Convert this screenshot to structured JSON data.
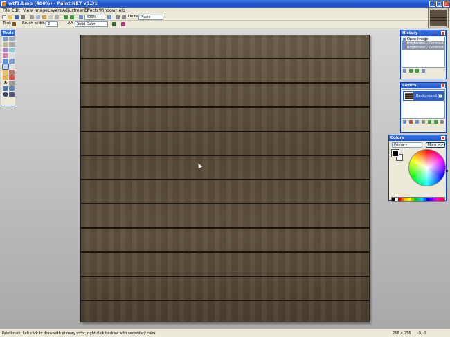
{
  "window": {
    "title": "wtf1.bmp (400%) - Paint.NET v3.31",
    "min_label": "_",
    "max_label": "□",
    "close_label": "×"
  },
  "menu": [
    "File",
    "Edit",
    "View",
    "Image",
    "Layers",
    "Adjustments",
    "Effects",
    "Window",
    "Help"
  ],
  "toolbar": {
    "zoom_value": "400%",
    "units_label": "Units:",
    "units_value": "Pixels"
  },
  "tool_options": {
    "tool_label": "Tool:",
    "brush_width_label": "Brush width:",
    "brush_width_value": "2",
    "aa_label": "AA",
    "fill_label": "Solid Color"
  },
  "panels": {
    "tools": {
      "title": "Tools"
    },
    "history": {
      "title": "History",
      "items": [
        {
          "label": "Open Image",
          "state": "active"
        },
        {
          "label": "Brightness / Contrast",
          "state": "undone"
        },
        {
          "label": "Brightness / Contrast",
          "state": "undone"
        }
      ]
    },
    "layers": {
      "title": "Layers",
      "items": [
        {
          "label": "Background",
          "visible": true
        }
      ]
    },
    "colors": {
      "title": "Colors",
      "mode": "Primary",
      "more_label": "More >>",
      "primary": "#000000",
      "secondary": "#ffffff"
    }
  },
  "status": {
    "hint": "Paintbrush: Left click to draw with primary color, right click to draw with secondary color",
    "image_size": "256 × 256",
    "cursor_pos": "-9, -9"
  },
  "colors": {
    "accent": "#1f52cc",
    "canvas_wood": "#5e5140"
  }
}
